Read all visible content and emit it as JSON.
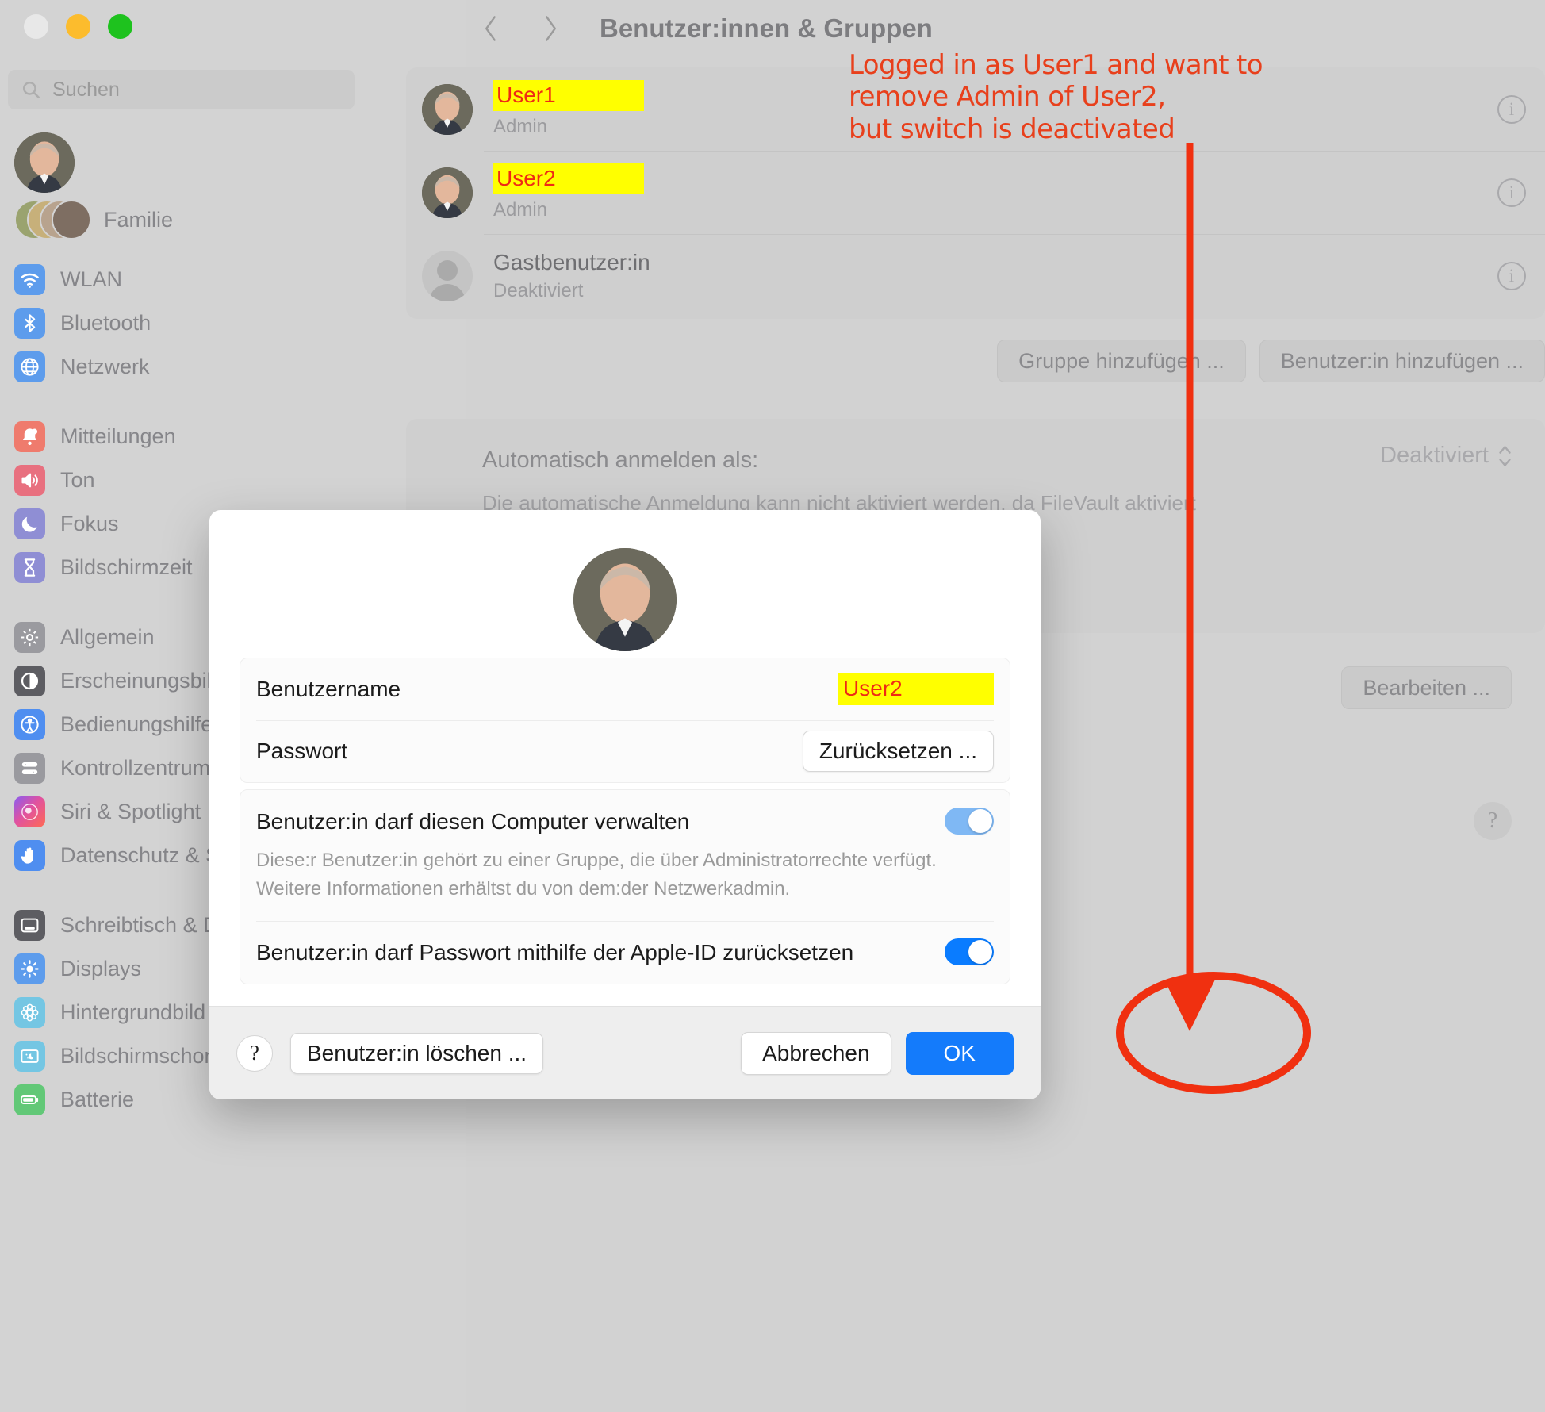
{
  "window": {
    "traffic_lights": [
      "close",
      "minimize",
      "zoom"
    ]
  },
  "sidebar": {
    "search": {
      "placeholder": "Suchen",
      "icon": "search-icon"
    },
    "account": {
      "avatar": "user-avatar",
      "family_label": "Familie"
    },
    "groups": [
      {
        "items": [
          {
            "label": "WLAN",
            "icon": "wifi-icon"
          },
          {
            "label": "Bluetooth",
            "icon": "bluetooth-icon"
          },
          {
            "label": "Netzwerk",
            "icon": "globe-icon"
          }
        ]
      },
      {
        "items": [
          {
            "label": "Mitteilungen",
            "icon": "bell-icon"
          },
          {
            "label": "Ton",
            "icon": "speaker-icon"
          },
          {
            "label": "Fokus",
            "icon": "moon-icon"
          },
          {
            "label": "Bildschirmzeit",
            "icon": "hourglass-icon"
          }
        ]
      },
      {
        "items": [
          {
            "label": "Allgemein",
            "icon": "gear-icon"
          },
          {
            "label": "Erscheinungsbild",
            "icon": "appearance-icon"
          },
          {
            "label": "Bedienungshilfen",
            "icon": "accessibility-icon"
          },
          {
            "label": "Kontrollzentrum",
            "icon": "control-center-icon"
          },
          {
            "label": "Siri & Spotlight",
            "icon": "siri-icon"
          },
          {
            "label": "Datenschutz & Sicherheit",
            "icon": "hand-icon"
          }
        ]
      },
      {
        "items": [
          {
            "label": "Schreibtisch & Dock",
            "icon": "dock-icon"
          },
          {
            "label": "Displays",
            "icon": "brightness-icon"
          },
          {
            "label": "Hintergrundbild",
            "icon": "wallpaper-icon"
          },
          {
            "label": "Bildschirmschoner",
            "icon": "screensaver-icon"
          },
          {
            "label": "Batterie",
            "icon": "battery-icon"
          }
        ]
      }
    ]
  },
  "main": {
    "title": "Benutzer:innen & Gruppen",
    "nav": {
      "back_icon": "chevron-left-icon",
      "forward_icon": "chevron-right-icon"
    },
    "users": [
      {
        "name": "User1",
        "role": "Admin",
        "highlighted": true,
        "avatar": "user-avatar",
        "info_icon": "info-icon"
      },
      {
        "name": "User2",
        "role": "Admin",
        "highlighted": true,
        "avatar": "user-avatar",
        "info_icon": "info-icon"
      },
      {
        "name": "Gastbenutzer:in",
        "role": "Deaktiviert",
        "highlighted": false,
        "avatar": "guest-avatar",
        "info_icon": "info-icon"
      }
    ],
    "buttons": {
      "add_group": "Gruppe hinzufügen ...",
      "add_user": "Benutzer:in hinzufügen ...",
      "edit": "Bearbeiten ...",
      "help": "?"
    },
    "auto_login": {
      "title": "Automatisch anmelden als:",
      "description": "Die automatische Anmeldung kann nicht aktiviert werden, da FileVault aktiviert ist.",
      "value": "Deaktiviert",
      "chevron_icon": "chevron-updown-icon"
    }
  },
  "dialog": {
    "avatar": "user-avatar",
    "fields": [
      {
        "label": "Benutzername",
        "value": "User2",
        "type": "highlighted-text"
      },
      {
        "label": "Passwort",
        "value": "Zurücksetzen ...",
        "type": "button"
      }
    ],
    "permissions": [
      {
        "title": "Benutzer:in darf diesen Computer verwalten",
        "description": "Diese:r Benutzer:in gehört zu einer Gruppe, die über Administratorrechte verfügt. Weitere Informationen erhältst du von dem:der Netzwerkadmin.",
        "toggle": "on-disabled"
      },
      {
        "title": "Benutzer:in darf Passwort mithilfe der Apple-ID zurücksetzen",
        "description": "",
        "toggle": "on"
      }
    ],
    "footer": {
      "help": "?",
      "delete_user": "Benutzer:in löschen ...",
      "cancel": "Abbrechen",
      "ok": "OK"
    }
  },
  "annotations": {
    "note": "Logged in as User1 and want to\nremove Admin of User2,\nbut switch is deactivated",
    "note_color": "#e8401c",
    "highlight_color": "#ffff00",
    "highlight_text_color": "#ef2a15",
    "arrow": "red-arrow-down",
    "ellipse": "red-ellipse-around-toggle"
  },
  "colors": {
    "accent_blue": "#0a7cff",
    "toggle_disabled_blue": "#7fb8f4",
    "annotation_red": "#e8401c",
    "sidebar_bg": "#d3d3d3",
    "main_bg": "#d2d2d2"
  }
}
